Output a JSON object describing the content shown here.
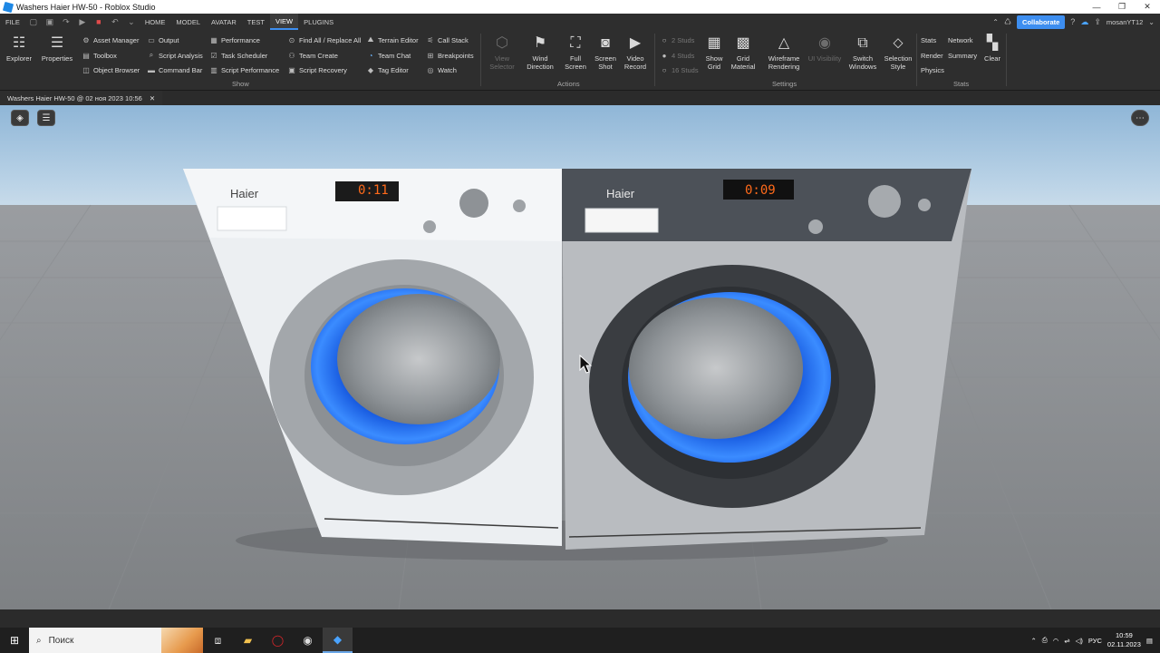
{
  "window": {
    "title": "Washers Haier HW-50 - Roblox Studio",
    "controls": [
      "—",
      "❐",
      "✕"
    ]
  },
  "menu": {
    "file": "FILE",
    "tabs": [
      "HOME",
      "MODEL",
      "AVATAR",
      "TEST",
      "VIEW",
      "PLUGINS"
    ],
    "active_tab": "VIEW",
    "collaborate": "Collaborate",
    "username": "mosanYT12"
  },
  "ribbon": {
    "explorer": "Explorer",
    "properties": "Properties",
    "show_items": [
      "Asset Manager",
      "Toolbox",
      "Object Browser",
      "Output",
      "Script Analysis",
      "Command Bar",
      "Performance",
      "Task Scheduler",
      "Script Performance",
      "Find All / Replace All",
      "Team Create",
      "Script Recovery",
      "Terrain Editor",
      "Team Chat",
      "Tag Editor",
      "Call Stack",
      "Breakpoints",
      "Watch"
    ],
    "show_label": "Show",
    "actions": {
      "view_selector": "View Selector",
      "wind_direction": "Wind Direction",
      "full_screen": "Full Screen",
      "screen_shot": "Screen Shot",
      "video_record": "Video Record",
      "label": "Actions"
    },
    "settings": {
      "studs": [
        "2 Studs",
        "4 Studs",
        "16 Studs"
      ],
      "show_grid": "Show Grid",
      "grid_material": "Grid Material",
      "wireframe": "Wireframe Rendering",
      "ui_visibility": "UI Visibility",
      "switch_windows": "Switch Windows",
      "selection_style": "Selection Style",
      "label": "Settings"
    },
    "stats": {
      "items": [
        "Stats",
        "Network",
        "Render",
        "Summary",
        "Physics"
      ],
      "clear": "Clear",
      "label": "Stats"
    }
  },
  "document_tab": {
    "label": "Washers Haier HW-50 @ 02 ноя 2023 10:56",
    "close": "✕"
  },
  "scene": {
    "left_washer": {
      "brand": "Haier",
      "display": "0:11"
    },
    "right_washer": {
      "brand": "Haier",
      "display": "0:09"
    }
  },
  "taskbar": {
    "search_placeholder": "Поиск",
    "language": "РУС",
    "time": "10:59",
    "date": "02.11.2023"
  },
  "colors": {
    "accent": "#3d8ef0",
    "display_text": "#ff6a1a",
    "drum_blue": "#2f7ef0"
  }
}
